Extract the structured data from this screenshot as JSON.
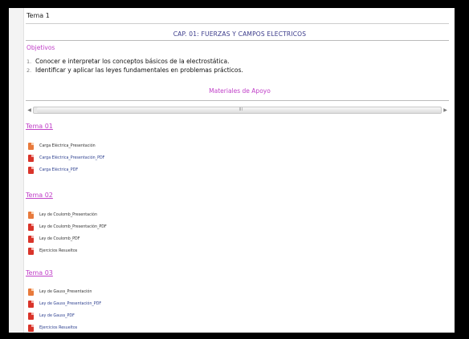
{
  "page": {
    "topic_title": "Tema 1",
    "chapter_title": "CAP. 01: FUERZAS Y CAMPOS ELECTRICOS"
  },
  "objectives": {
    "title": "Objetivos",
    "items": [
      {
        "num": "1.",
        "text": "Conocer e interpretar los conceptos básicos de la electrostática."
      },
      {
        "num": "2.",
        "text": "Identificar y aplicar las leyes fundamentales en problemas prácticos."
      }
    ]
  },
  "materials": {
    "title": "Materiales de Apoyo"
  },
  "scrollbar": {
    "left_arrow": "◀",
    "right_arrow": "▶",
    "grip": "III"
  },
  "sections": [
    {
      "title": "Tema 01",
      "files": [
        {
          "label": "Carga Eléctrica_Presentación",
          "icon": "ppt-icon"
        },
        {
          "label": "Carga Eléctrica_Presentación_PDF",
          "icon": "pdf-icon"
        },
        {
          "label": "Carga Eléctrica_PDF",
          "icon": "pdf-icon"
        }
      ]
    },
    {
      "title": "Tema 02",
      "files": [
        {
          "label": "Ley de Coulomb_Presentación",
          "icon": "ppt-icon"
        },
        {
          "label": "Ley de Coulomb_Presentación_PDF",
          "icon": "pdf-icon"
        },
        {
          "label": "Ley de Coulomb_PDF",
          "icon": "pdf-icon"
        },
        {
          "label": "Ejercicios Resueltos",
          "icon": "pdf-icon"
        }
      ]
    },
    {
      "title": "Tema 03",
      "files": [
        {
          "label": "Ley de Gauss_Presentación",
          "icon": "ppt-icon"
        },
        {
          "label": "Ley de Gauss_Presentación_PDF",
          "icon": "pdf-icon"
        },
        {
          "label": "Ley de Gauss_PDF",
          "icon": "pdf-icon"
        },
        {
          "label": "Ejercicios Resueltos",
          "icon": "pdf-icon"
        }
      ]
    }
  ]
}
